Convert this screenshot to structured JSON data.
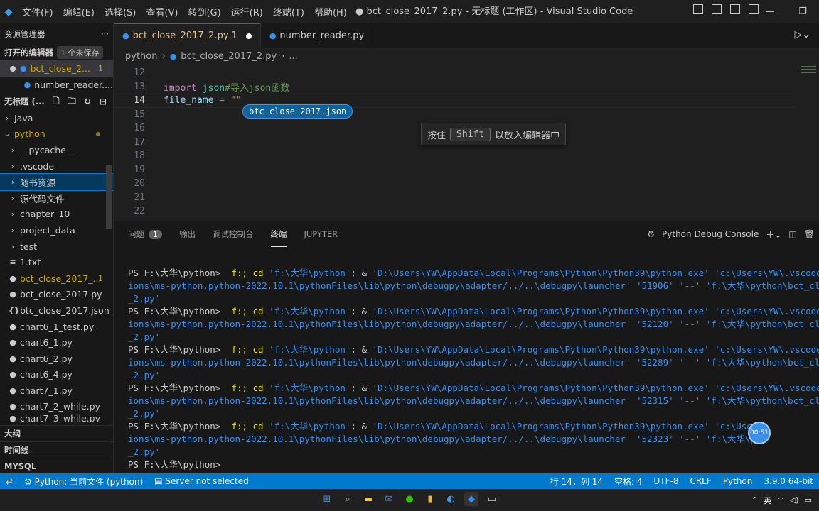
{
  "titlebar": {
    "menus": [
      "文件(F)",
      "编辑(E)",
      "选择(S)",
      "查看(V)",
      "转到(G)",
      "运行(R)",
      "终端(T)",
      "帮助(H)"
    ],
    "window_title": "● bct_close_2017_2.py - 无标题 (工作区) - Visual Studio Code"
  },
  "sidebar": {
    "title": "资源管理器",
    "more": "···",
    "open_editors_label": "打开的编辑器",
    "unsaved_badge": "1 个未保存",
    "open_editors": [
      {
        "name": "bct_close_2...",
        "count": "1"
      },
      {
        "name": "number_reader...."
      }
    ],
    "workspace_label": "无标题 (...",
    "tree": [
      {
        "name": "Java",
        "type": "folder"
      },
      {
        "name": "python",
        "type": "folder-open"
      },
      {
        "name": "__pycache__",
        "type": "folder"
      },
      {
        "name": ".vscode",
        "type": "folder"
      },
      {
        "name": "随书资源",
        "type": "folder"
      },
      {
        "name": "源代码文件",
        "type": "folder"
      },
      {
        "name": "chapter_10",
        "type": "folder"
      },
      {
        "name": "project_data",
        "type": "folder"
      },
      {
        "name": "test",
        "type": "folder"
      },
      {
        "name": "1.txt",
        "type": "txt"
      },
      {
        "name": "bct_close_2017_...",
        "type": "py",
        "count": "1"
      },
      {
        "name": "bct_close_2017.py",
        "type": "py"
      },
      {
        "name": "btc_close_2017.json",
        "type": "json"
      },
      {
        "name": "chart6_1_test.py",
        "type": "py"
      },
      {
        "name": "chart6_1.py",
        "type": "py"
      },
      {
        "name": "chart6_2.py",
        "type": "py"
      },
      {
        "name": "chart6_4.py",
        "type": "py"
      },
      {
        "name": "chart7_1.py",
        "type": "py"
      },
      {
        "name": "chart7_2_while.py",
        "type": "py"
      },
      {
        "name": "chart7_3_while.py",
        "type": "py"
      }
    ],
    "bottom_sections": [
      "大纲",
      "时间线",
      "MYSQL"
    ]
  },
  "tabs": [
    {
      "label": "bct_close_2017_2.py",
      "count": "1"
    },
    {
      "label": "number_reader.py"
    }
  ],
  "breadcrumb": [
    "python",
    "bct_close_2017_2.py",
    "..."
  ],
  "editor": {
    "lines": [
      {
        "n": "12"
      },
      {
        "n": "13"
      },
      {
        "n": "14"
      },
      {
        "n": "15"
      },
      {
        "n": "16"
      },
      {
        "n": "17"
      },
      {
        "n": "18"
      },
      {
        "n": "19"
      },
      {
        "n": "20"
      },
      {
        "n": "21"
      },
      {
        "n": "22"
      }
    ],
    "code13": {
      "kw": "import",
      "mod": "json",
      "cmt": "#导入json函数"
    },
    "code14": {
      "var": "file_name",
      "op": " = ",
      "str": "\"\""
    },
    "drag_label": "btc_close_2017.json",
    "hint_prefix": "按住",
    "hint_key": "Shift",
    "hint_suffix": "以放入编辑器中"
  },
  "panel": {
    "tabs": [
      {
        "label": "问题",
        "badge": "1"
      },
      {
        "label": "输出"
      },
      {
        "label": "调试控制台"
      },
      {
        "label": "终端"
      },
      {
        "label": "JUPYTER"
      }
    ],
    "terminal_name": "Python Debug Console",
    "terminal": [
      {
        "prompt": "PS F:\\大华\\python> ",
        "cmd": " f:; cd ",
        "p1": "'f:\\大华\\python'",
        "amp": "; & ",
        "p2": "'D:\\Users\\YW\\AppData\\Local\\Programs\\Python\\Python39\\python.exe'",
        "p3": " 'c:\\Users\\YW\\.vscode\\e",
        "l2": "ions\\ms-python.python-2022.10.1\\pythonFiles\\lib\\python\\debugpy\\adapter/../..\\debugpy\\launcher'",
        "port": " '51906' ",
        "l2b": "'--' 'f:\\大华\\python\\bct_close",
        "l3": "_2.py'"
      },
      {
        "prompt": "PS F:\\大华\\python> ",
        "cmd": " f:; cd ",
        "p1": "'f:\\大华\\python'",
        "amp": "; & ",
        "p2": "'D:\\Users\\YW\\AppData\\Local\\Programs\\Python\\Python39\\python.exe'",
        "p3": " 'c:\\Users\\YW\\.vscode\\e",
        "l2": "ions\\ms-python.python-2022.10.1\\pythonFiles\\lib\\python\\debugpy\\adapter/../..\\debugpy\\launcher'",
        "port": " '52120' ",
        "l2b": "'--' 'f:\\大华\\python\\bct_close",
        "l3": "_2.py'"
      },
      {
        "prompt": "PS F:\\大华\\python> ",
        "cmd": " f:; cd ",
        "p1": "'f:\\大华\\python'",
        "amp": "; & ",
        "p2": "'D:\\Users\\YW\\AppData\\Local\\Programs\\Python\\Python39\\python.exe'",
        "p3": " 'c:\\Users\\YW\\.vscode\\e",
        "l2": "ions\\ms-python.python-2022.10.1\\pythonFiles\\lib\\python\\debugpy\\adapter/../..\\debugpy\\launcher'",
        "port": " '52289' ",
        "l2b": "'--' 'f:\\大华\\python\\bct_close",
        "l3": "_2.py'"
      },
      {
        "prompt": "PS F:\\大华\\python> ",
        "cmd": " f:; cd ",
        "p1": "'f:\\大华\\python'",
        "amp": "; & ",
        "p2": "'D:\\Users\\YW\\AppData\\Local\\Programs\\Python\\Python39\\python.exe'",
        "p3": " 'c:\\Users\\YW\\.vscode\\e",
        "l2": "ions\\ms-python.python-2022.10.1\\pythonFiles\\lib\\python\\debugpy\\adapter/../..\\debugpy\\launcher'",
        "port": " '52315' ",
        "l2b": "'--' 'f:\\大华\\python\\bct_close",
        "l3": "_2.py'"
      },
      {
        "prompt": "PS F:\\大华\\python> ",
        "cmd": " f:; cd ",
        "p1": "'f:\\大华\\python'",
        "amp": "; & ",
        "p2": "'D:\\Users\\YW\\AppData\\Local\\Programs\\Python\\Python39\\python.exe'",
        "p3": " 'c:\\User",
        "l2": "ions\\ms-python.python-2022.10.1\\pythonFiles\\lib\\python\\debugpy\\adapter/../..\\debugpy\\launcher'",
        "port": " '52323' ",
        "l2b": "'--' 'f:\\大华\\py",
        "l3": "_2.py'"
      }
    ],
    "final_prompt": "PS F:\\大华\\python> ",
    "timer": "00:51"
  },
  "statusbar": {
    "interpreter": "Python: 当前文件 (python)",
    "server": "Server not selected",
    "position": "行 14，列 14",
    "spaces": "空格: 4",
    "encoding": "UTF-8",
    "eol": "CRLF",
    "language": "Python",
    "version": "3.9.0 64-bit"
  },
  "taskbar": {
    "lang": "英"
  },
  "colors": {
    "accent": "#007acc",
    "warning": "#cca700"
  }
}
